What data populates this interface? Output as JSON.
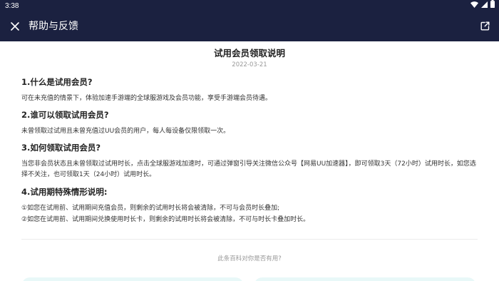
{
  "status_bar": {
    "time": "3:38",
    "icons": [
      "wifi-icon",
      "signal-icon",
      "battery-icon"
    ]
  },
  "app_bar": {
    "title": "帮助与反馈",
    "left_icon": "close-icon",
    "right_icon": "external-link-icon",
    "background": "#1b2140"
  },
  "article": {
    "title": "试用会员领取说明",
    "date": "2022-03-21",
    "sections": [
      {
        "heading": "1.什么是试用会员?",
        "paragraphs": [
          "可在未充值的情景下，体验加速手游端的全球服游戏及会员功能，享受手游端会员待遇。"
        ]
      },
      {
        "heading": "2.谁可以领取试用会员?",
        "paragraphs": [
          "未曾领取过试用且未曾充值过UU会员的用户，每人每设备仅限领取一次。"
        ]
      },
      {
        "heading": "3.如何领取试用会员?",
        "paragraphs": [
          "当您非会员状态且未曾领取过试用时长，点击全球服游戏加速时，可通过弹窗引导关注微信公众号【网易UU加速器】，即可领取3天（72小时）试用时长，如您选择不关注，也可领取1天（24小时）试用时长。"
        ]
      },
      {
        "heading": "4.试用期特殊情形说明:",
        "paragraphs": [
          "①如您在试用前、试用期间充值会员，则剩余的试用时长将会被清除，不可与会员时长叠加;",
          "②如您在试用前、试用期间兑换使用时长卡，则剩余的试用时长将会被清除，不可与时长卡叠加时长。"
        ]
      }
    ]
  },
  "feedback": {
    "question": "此条百科对你是否有用?",
    "button_color": "#e8f8f8"
  }
}
